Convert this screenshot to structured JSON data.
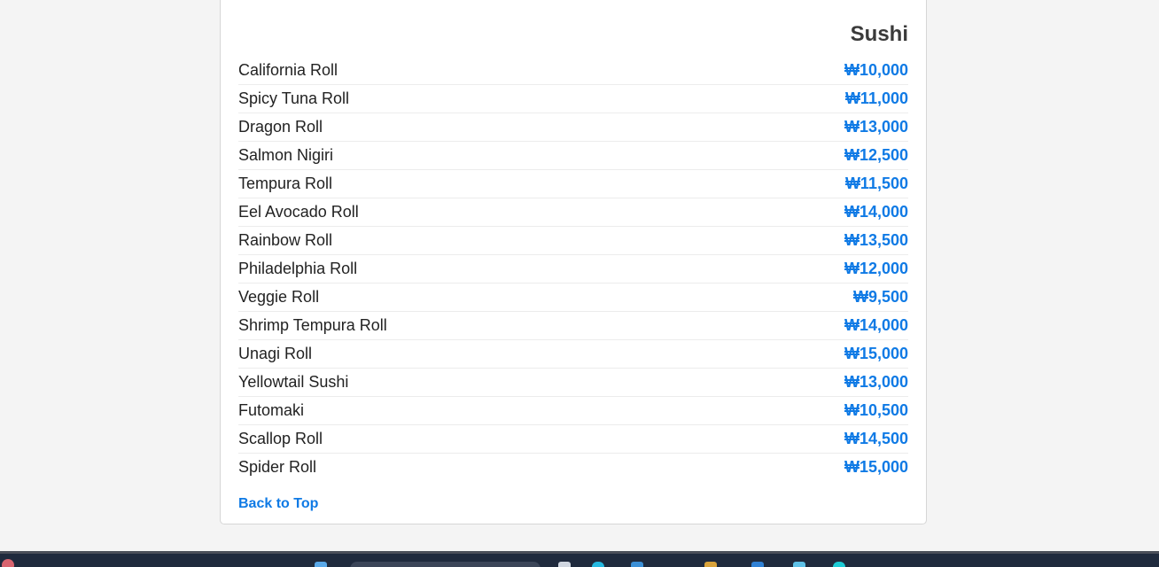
{
  "section": {
    "title": "Sushi"
  },
  "menu": {
    "items": [
      {
        "name": "California Roll",
        "price": "₩10,000"
      },
      {
        "name": "Spicy Tuna Roll",
        "price": "₩11,000"
      },
      {
        "name": "Dragon Roll",
        "price": "₩13,000"
      },
      {
        "name": "Salmon Nigiri",
        "price": "₩12,500"
      },
      {
        "name": "Tempura Roll",
        "price": "₩11,500"
      },
      {
        "name": "Eel Avocado Roll",
        "price": "₩14,000"
      },
      {
        "name": "Rainbow Roll",
        "price": "₩13,500"
      },
      {
        "name": "Philadelphia Roll",
        "price": "₩12,000"
      },
      {
        "name": "Veggie Roll",
        "price": "₩9,500"
      },
      {
        "name": "Shrimp Tempura Roll",
        "price": "₩14,000"
      },
      {
        "name": "Unagi Roll",
        "price": "₩15,000"
      },
      {
        "name": "Yellowtail Sushi",
        "price": "₩13,000"
      },
      {
        "name": "Futomaki",
        "price": "₩10,500"
      },
      {
        "name": "Scallop Roll",
        "price": "₩14,500"
      },
      {
        "name": "Spider Roll",
        "price": "₩15,000"
      }
    ]
  },
  "back_to_top_label": "Back to Top",
  "colors": {
    "price": "#0f7ae5",
    "link": "#0f7ae5",
    "title": "#3a3a3a",
    "background": "#f4f4f4"
  },
  "taskbar": {
    "icons": [
      "notification-badge-icon",
      "search-box",
      "windows-icon",
      "edge-icon",
      "file-explorer-icon",
      "store-icon",
      "mail-icon",
      "chat-icon"
    ]
  }
}
